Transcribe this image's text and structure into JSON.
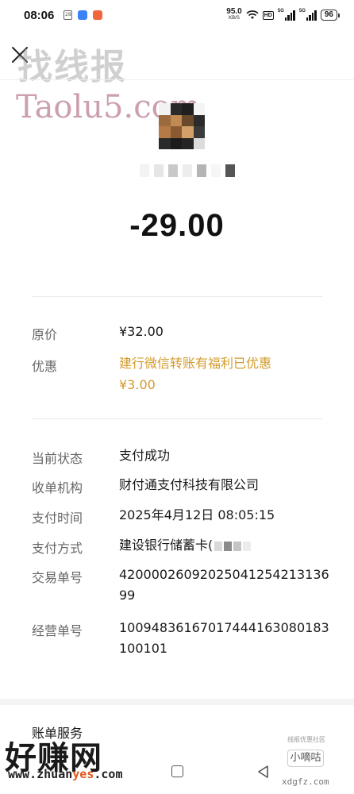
{
  "status_bar": {
    "time": "08:06",
    "calendar_day": "28",
    "network_speed": "95.0",
    "network_unit": "KB/S",
    "hd_label": "HD",
    "sim1_label": "5G",
    "sim2_label": "5G",
    "battery": "96"
  },
  "watermarks": {
    "top_text": "找线报",
    "site_text": "Taolu5.com",
    "bottom_text": "好赚网",
    "bottom_url_prefix": "www.zhuan",
    "bottom_url_highlight": "yes",
    "bottom_url_suffix": ".com",
    "badge_small": "小嘀咕",
    "badge_top": "线报优惠社区",
    "badge_url": "xdgfz.com"
  },
  "transaction": {
    "amount": "-29.00"
  },
  "pricing": {
    "original_label": "原价",
    "original_value": "¥32.00",
    "discount_label": "优惠",
    "discount_desc": "建行微信转账有福利已优惠",
    "discount_value": "¥3.00"
  },
  "details": {
    "status_label": "当前状态",
    "status_value": "支付成功",
    "institution_label": "收单机构",
    "institution_value": "财付通支付科技有限公司",
    "time_label": "支付时间",
    "time_value": "2025年4月12日 08:05:15",
    "method_label": "支付方式",
    "method_value": "建设银行储蓄卡(",
    "order_label": "交易单号",
    "order_value": "4200002609202504125421313699",
    "merchant_order_label": "经营单号",
    "merchant_order_value": "10094836167017444163080183100101"
  },
  "footer": {
    "bill_service_label": "账单服务"
  },
  "colors": {
    "accent_orange": "#d39b2b",
    "label_gray": "#666666",
    "background": "#ffffff"
  },
  "icons": {
    "close": "close-icon",
    "nav_home": "square-icon",
    "nav_back": "triangle-back-icon"
  }
}
